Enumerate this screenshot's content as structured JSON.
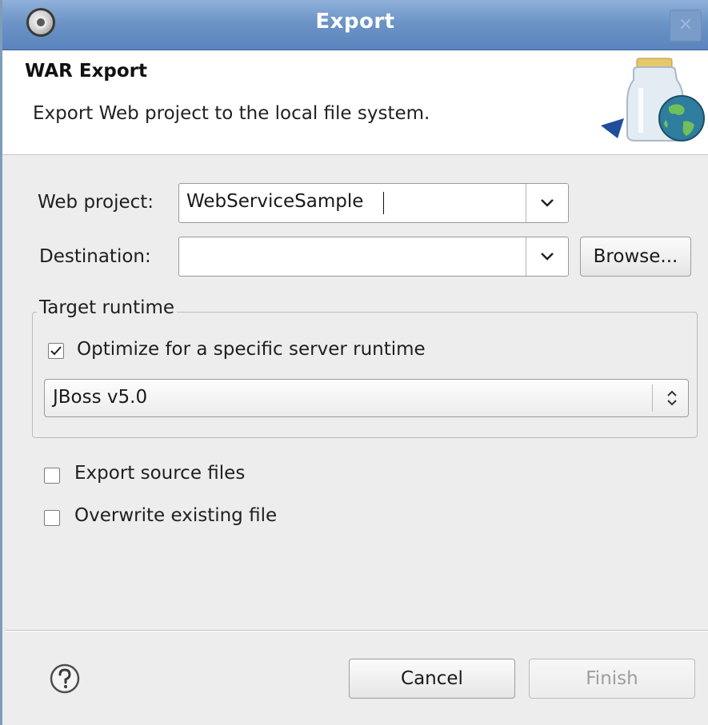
{
  "window": {
    "title": "Export",
    "close_glyph": "✕",
    "app_icon": "eclipse-icon"
  },
  "banner": {
    "title": "WAR Export",
    "description": "Export Web project to the local file system.",
    "icon": "war-jar-globe-icon"
  },
  "form": {
    "web_project_label": "Web project:",
    "web_project_value": "WebServiceSample",
    "destination_label": "Destination:",
    "destination_value": "",
    "browse_label": "Browse...",
    "target_runtime": {
      "legend": "Target runtime",
      "optimize_label": "Optimize for a specific server runtime",
      "optimize_checked": true,
      "runtime_value": "JBoss v5.0"
    },
    "export_source_label": "Export source files",
    "export_source_checked": false,
    "overwrite_label": "Overwrite existing file",
    "overwrite_checked": false
  },
  "footer": {
    "help_icon": "help-icon",
    "cancel_label": "Cancel",
    "finish_label": "Finish",
    "finish_enabled": false
  }
}
